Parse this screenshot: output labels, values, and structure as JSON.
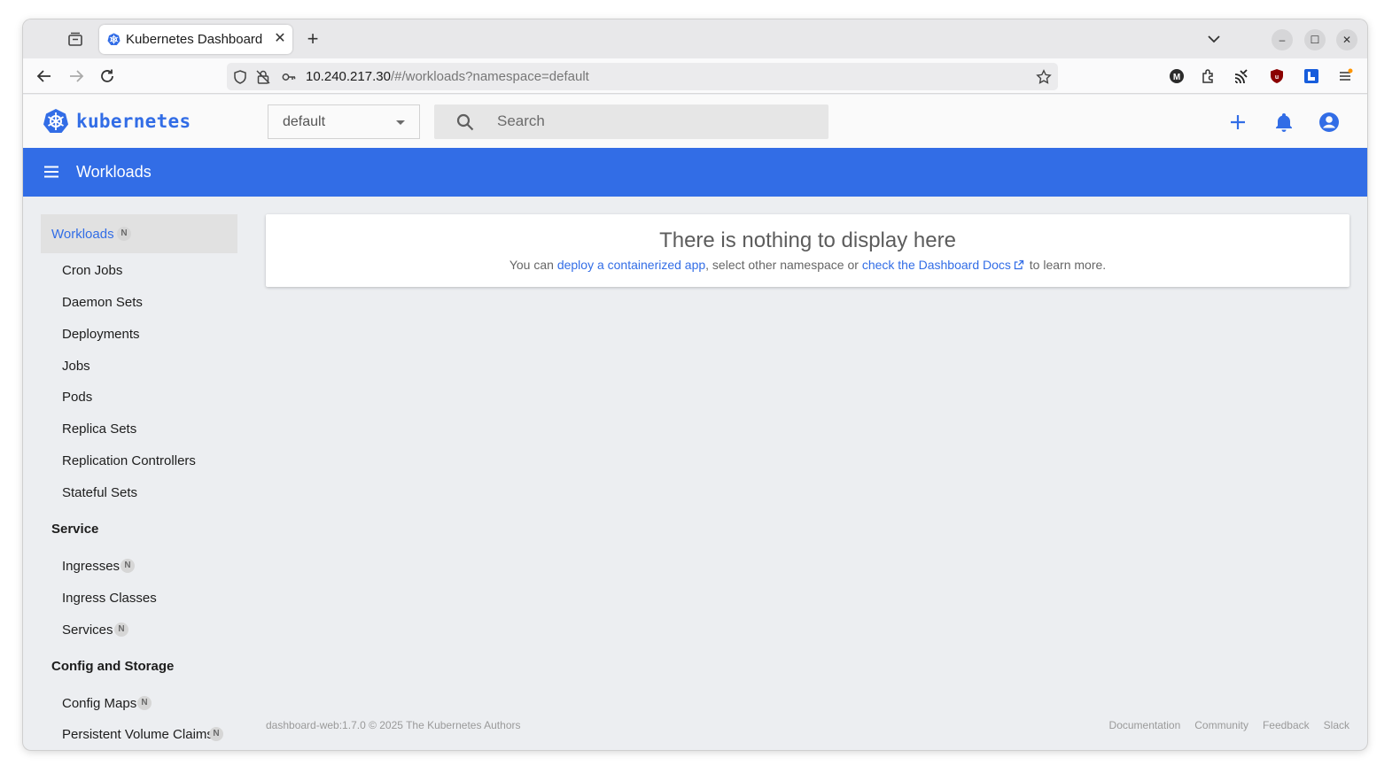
{
  "browser": {
    "tab_title": "Kubernetes Dashboard",
    "url_host": "10.240.217.30",
    "url_path": "/#/workloads?namespace=default"
  },
  "header": {
    "brand": "kubernetes",
    "namespace": "default",
    "search_placeholder": "Search"
  },
  "toolbar": {
    "title": "Workloads"
  },
  "sidebar": {
    "items": [
      {
        "label": "Workloads",
        "badge": "N"
      },
      {
        "label": "Cron Jobs"
      },
      {
        "label": "Daemon Sets"
      },
      {
        "label": "Deployments"
      },
      {
        "label": "Jobs"
      },
      {
        "label": "Pods"
      },
      {
        "label": "Replica Sets"
      },
      {
        "label": "Replication Controllers"
      },
      {
        "label": "Stateful Sets"
      },
      {
        "label": "Service"
      },
      {
        "label": "Ingresses",
        "badge": "N"
      },
      {
        "label": "Ingress Classes"
      },
      {
        "label": "Services",
        "badge": "N"
      },
      {
        "label": "Config and Storage"
      },
      {
        "label": "Config Maps",
        "badge": "N"
      },
      {
        "label": "Persistent Volume Claims",
        "badge": "N"
      }
    ]
  },
  "main": {
    "heading": "There is nothing to display here",
    "msg_prefix": "You can ",
    "link_deploy": "deploy a containerized app",
    "msg_middle": ", select other namespace or ",
    "link_docs": "check the Dashboard Docs",
    "msg_suffix": " to learn more."
  },
  "footer": {
    "version": "dashboard-web:1.7.0 © 2025 The Kubernetes Authors",
    "links": [
      "Documentation",
      "Community",
      "Feedback",
      "Slack"
    ]
  },
  "colors": {
    "accent": "#326de6"
  }
}
